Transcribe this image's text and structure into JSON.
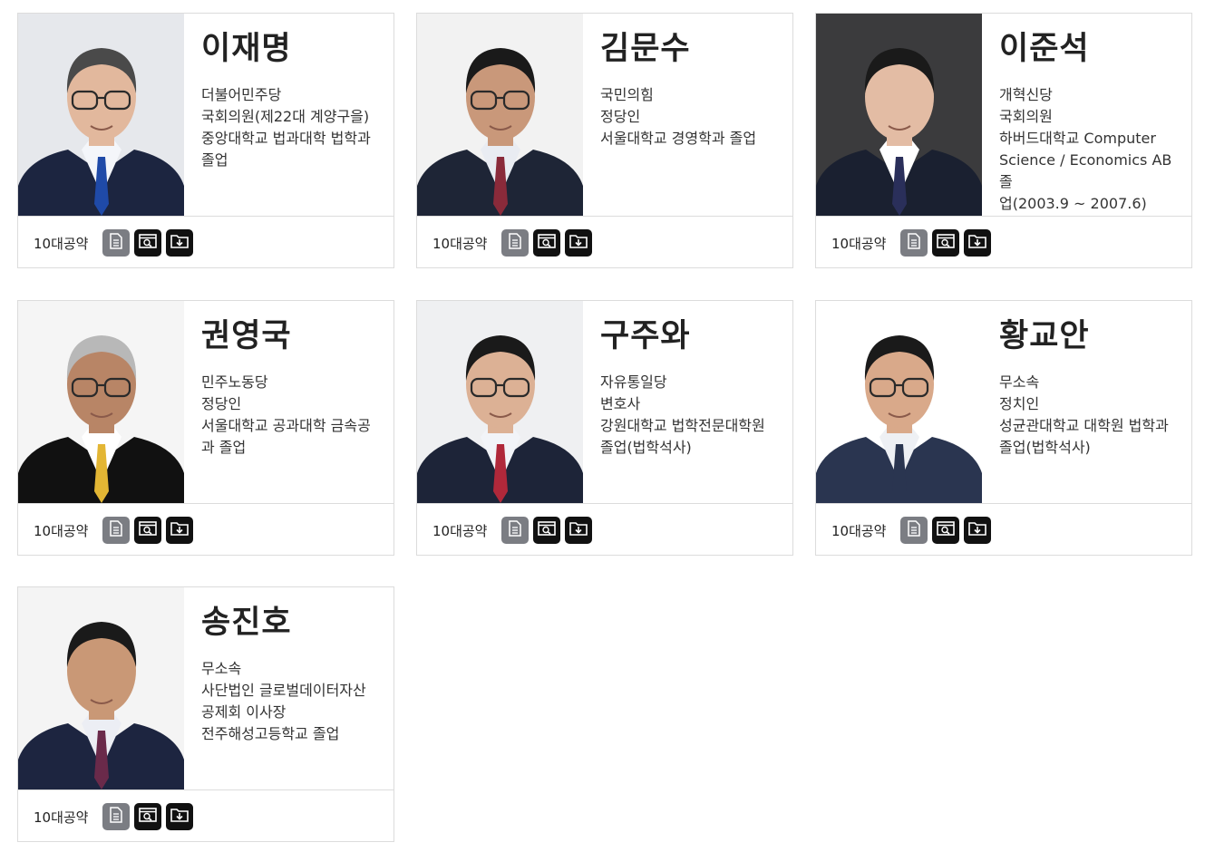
{
  "footer_label": "10대공약",
  "candidates": [
    {
      "name": "이재명",
      "lines": [
        "더불어민주당",
        "국회의원(제22대 계양구을)",
        "중앙대학교 법과대학 법학과",
        "졸업"
      ],
      "bg": "#e6e8ec",
      "suit": "#1c2540",
      "shirt": "#f4f6fa",
      "tie": "#1f4aa8",
      "hair": "#4a4a4a",
      "skin": "#e2b89d",
      "glasses": true
    },
    {
      "name": "김문수",
      "lines": [
        "국민의힘",
        "정당인",
        "서울대학교 경영학과 졸업"
      ],
      "bg": "#f2f2f2",
      "suit": "#1e2536",
      "shirt": "#e9ecf2",
      "tie": "#8a2a3a",
      "hair": "#1a1a1a",
      "skin": "#c9987a",
      "glasses": true
    },
    {
      "name": "이준석",
      "lines": [
        "개혁신당",
        "국회의원",
        "하버드대학교 Computer",
        "Science / Economics AB 졸",
        "업(2003.9 ~ 2007.6)"
      ],
      "bg": "#3b3b3d",
      "suit": "#1a2030",
      "shirt": "#ffffff",
      "tie": "#2a2f5a",
      "hair": "#1a1a1a",
      "skin": "#e3bca4",
      "glasses": false
    },
    {
      "name": "권영국",
      "lines": [
        "민주노동당",
        "정당인",
        "서울대학교 공과대학 금속공",
        "과 졸업"
      ],
      "bg": "#f5f5f5",
      "suit": "#111111",
      "shirt": "#ffffff",
      "tie": "#e3b634",
      "hair": "#b8b8b8",
      "skin": "#b88566",
      "glasses": true
    },
    {
      "name": "구주와",
      "lines": [
        "자유통일당",
        "변호사",
        "강원대학교 법학전문대학원",
        "졸업(법학석사)"
      ],
      "bg": "#eff0f2",
      "suit": "#1d2438",
      "shirt": "#f2f4f8",
      "tie": "#b0283a",
      "hair": "#1a1a1a",
      "skin": "#dcb195",
      "glasses": true
    },
    {
      "name": "황교안",
      "lines": [
        "무소속",
        "정치인",
        "성균관대학교 대학원 법학과",
        "졸업(법학석사)"
      ],
      "bg": "#ffffff",
      "suit": "#2a3550",
      "shirt": "#eef0f4",
      "tie": "#2a3550",
      "hair": "#1a1a1a",
      "skin": "#d9a98a",
      "glasses": true
    },
    {
      "name": "송진호",
      "lines": [
        "무소속",
        "사단법인 글로벌데이터자산",
        "공제회 이사장",
        "전주해성고등학교 졸업"
      ],
      "bg": "#f4f4f4",
      "suit": "#1d2540",
      "shirt": "#eceef4",
      "tie": "#6a2a4a",
      "hair": "#1a1a1a",
      "skin": "#c99876",
      "glasses": false
    }
  ],
  "icons": {
    "doc": "document-list-icon",
    "view": "preview-search-icon",
    "down": "download-folder-icon"
  }
}
